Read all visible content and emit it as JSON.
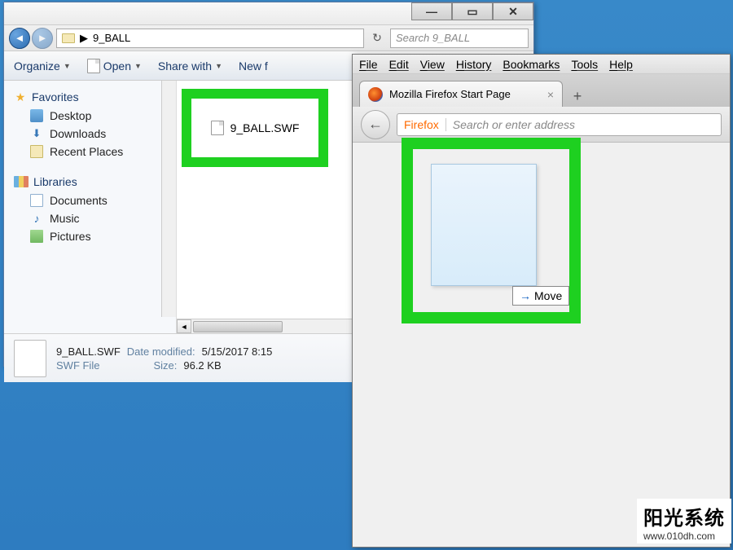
{
  "desktop": {
    "folder_visible": true
  },
  "explorer": {
    "window_controls": {
      "minimize": "—",
      "maximize": "▭",
      "close": "✕"
    },
    "address": {
      "path": "9_BALL",
      "arrow": "▶"
    },
    "search": {
      "placeholder": "Search 9_BALL"
    },
    "refresh": "↻",
    "toolbar": {
      "organize": "Organize",
      "open": "Open",
      "share": "Share with",
      "new": "New f"
    },
    "sidebar": {
      "favorites": {
        "label": "Favorites",
        "items": [
          "Desktop",
          "Downloads",
          "Recent Places"
        ]
      },
      "libraries": {
        "label": "Libraries",
        "items": [
          "Documents",
          "Music",
          "Pictures"
        ]
      }
    },
    "file": {
      "name": "9_BALL.SWF"
    },
    "details": {
      "filename": "9_BALL.SWF",
      "filetype": "SWF File",
      "modified_label": "Date modified:",
      "modified_value": "5/15/2017 8:15",
      "size_label": "Size:",
      "size_value": "96.2 KB"
    }
  },
  "firefox": {
    "menus": [
      "File",
      "Edit",
      "View",
      "History",
      "Bookmarks",
      "Tools",
      "Help"
    ],
    "tab": {
      "title": "Mozilla Firefox Start Page",
      "close": "×",
      "new": "+"
    },
    "navbar": {
      "back": "←",
      "brand": "Firefox",
      "placeholder": "Search or enter address"
    },
    "drag": {
      "tooltip": "Move",
      "arrow": "→"
    }
  },
  "watermark": {
    "line1": "阳光系统",
    "line2": "www.010dh.com"
  }
}
